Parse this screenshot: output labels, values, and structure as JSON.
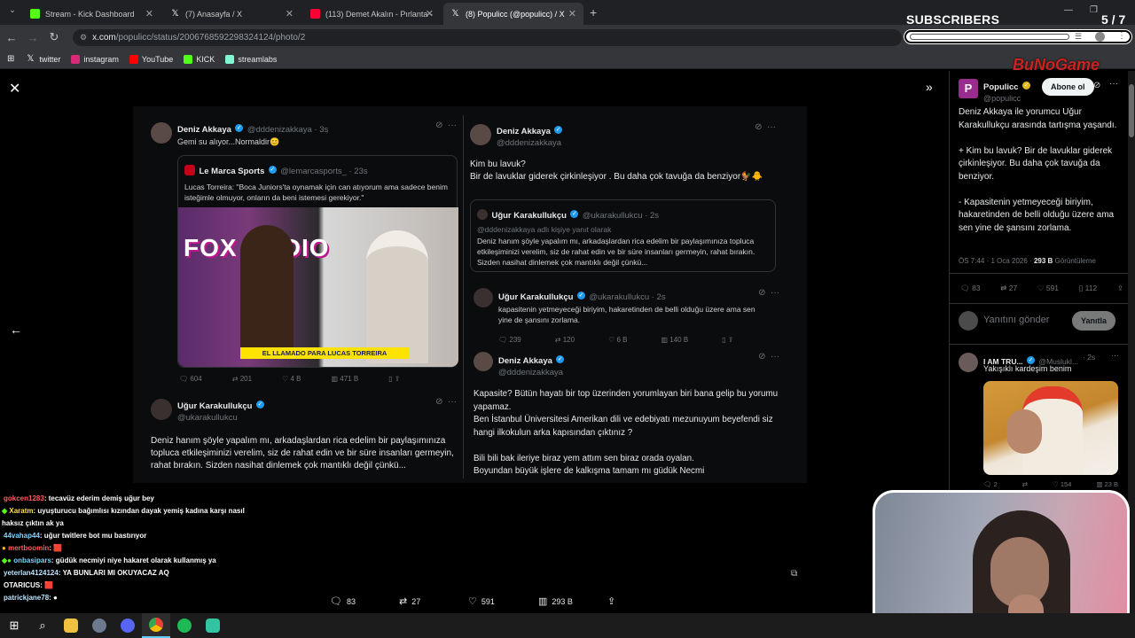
{
  "browser": {
    "tabs": [
      {
        "label": "Stream - Kick Dashboard",
        "color": "#53fc18"
      },
      {
        "label": "(7) Anasayfa / X",
        "color": "#ffffff"
      },
      {
        "label": "(113) Demet Akalın - Pırlanta -",
        "color": "#ff0033"
      },
      {
        "label": "(8) Populicc (@populicc) / X",
        "color": "#ffffff"
      }
    ],
    "new_tab": "+",
    "url_host": "x.com",
    "url_path": "/populicc/status/2006768592298324124/photo/2",
    "bookmarks": [
      {
        "label": "twitter",
        "color": "#ffffff"
      },
      {
        "label": "instagram",
        "color": "#d62976"
      },
      {
        "label": "YouTube",
        "color": "#ff0000"
      },
      {
        "label": "KICK",
        "color": "#53fc18"
      },
      {
        "label": "streamlabs",
        "color": "#80f5d2"
      }
    ]
  },
  "overlay": {
    "subscribers_label": "SUBSCRIBERS",
    "subscribers_count": "5 / 7",
    "logo_text": "BuNoGame"
  },
  "image": {
    "left_col": {
      "tweet1": {
        "name": "Deniz Akkaya",
        "handle": "@dddenizakkaya · 3s",
        "text": "Gemi su alıyor...Normaldir😊"
      },
      "quote": {
        "name": "Le Marca Sports",
        "handle": "@lemarcasports_ · 23s",
        "text": "Lucas Torreira: \"Boca Juniors'ta oynamak için can atıyorum ama sadece benim isteğimle olmuyor, onların da beni istemesi gerekiyor.\"",
        "photo_caption": "EL LLAMADO PARA LUCAS TORREIRA",
        "photo_logo": "FOX RADIO"
      },
      "metrics": [
        "604",
        "201",
        "4 B",
        "471 B"
      ],
      "tweet2": {
        "name": "Uğur Karakullukçu",
        "handle": "@ukarakullukcu",
        "text": "Deniz hanım şöyle yapalım mı, arkadaşlardan rica edelim bir paylaşımınıza topluca etkileşiminizi verelim, siz de rahat edin ve bir süre insanları germeyin, rahat bırakın. Sizden nasihat dinlemek çok mantıklı değil çünkü..."
      }
    },
    "right_col": {
      "tweet1": {
        "name": "Deniz Akkaya",
        "handle": "@dddenizakkaya",
        "text": "Kim bu lavuk?\nBir de lavuklar giderek çirkinleşiyor . Bu daha çok tavuğa da benziyor🐓🐥"
      },
      "quote": {
        "name": "Uğur Karakullukçu",
        "handle": "@ukarakullukcu · 2s",
        "reply_to": "@dddenizakkaya adlı kişiye yanıt olarak",
        "text": "Deniz hanım şöyle yapalım mı, arkadaşlardan rica edelim bir paylaşımınıza topluca etkileşiminizi verelim, siz de rahat edin ve bir süre insanları germeyin, rahat bırakın. Sizden nasihat dinlemek çok mantıklı değil çünkü..."
      },
      "tweet2": {
        "name": "Uğur Karakullukçu",
        "handle": "@ukarakullukcu · 2s",
        "text": "kapasitenin yetmeyeceği biriyim, hakaretinden de belli olduğu üzere ama sen yine de şansını zorlama.",
        "metrics": [
          "239",
          "120",
          "6 B",
          "140 B"
        ]
      },
      "tweet3": {
        "name": "Deniz Akkaya",
        "handle": "@dddenizakkaya",
        "text": "Kapasite? Bütün hayatı bir top üzerinden yorumlayan biri bana gelip bu yorumu yapamaz.\nBen İstanbul Üniversitesi Amerikan dili ve edebiyatı mezunuyum beyefendi siz hangi ilkokulun arka kapısından çıktınız ?\n\nBili bili bak ileriye biraz yem attım sen biraz orada oyalan.\nBoyundan büyük işlere de kalkışma tamam mı güdük Necmi"
      }
    }
  },
  "action_bar": {
    "replies": "83",
    "reposts": "27",
    "likes": "591",
    "views": "293 B"
  },
  "chat": [
    {
      "user": "gokcen1283",
      "color": "#ff5c5c",
      "text": ": tecavüz ederim demiş uğur bey"
    },
    {
      "user": "Xaratm",
      "color": "#ffe14d",
      "text": ": uyuşturucu bağımlısı kızından dayak yemiş kadına karşı nasıl haksız çıktın ak ya"
    },
    {
      "user": "44vahap44",
      "color": "#7fd4ff",
      "text": ": uğur twitlere bot mu bastırıyor"
    },
    {
      "user": "mertboomin",
      "color": "#ff5c5c",
      "text": ": 🟥"
    },
    {
      "user": "onbasipars",
      "color": "#7fd4ff",
      "text": ": güdük necmiyi niye hakaret olarak kullanmış ya"
    },
    {
      "user": "yeterlan4124124",
      "color": "#b9e3ff",
      "text": ": YA BUNLARI MI OKUYACAZ AQ"
    },
    {
      "user": "OTARICUS",
      "color": "#ffffff",
      "text": ": 🟥"
    },
    {
      "user": "patrickjane78",
      "color": "#b9e3ff",
      "text": ": ●"
    }
  ],
  "panel": {
    "name": "Populicc",
    "handle": "@populicc",
    "follow": "Abone ol",
    "body": "Deniz Akkaya ile yorumcu Uğur Karakullukçu arasında tartışma yaşandı.\n\n+ Kim bu lavuk? Bir de lavuklar giderek çirkinleşiyor. Bu daha çok tavuğa da benziyor.\n\n- Kapasitenin yetmeyeceği biriyim, hakaretinden de belli olduğu üzere ama sen yine de şansını zorlama.",
    "timestamp": "ÖS 7:44 · 1 Oca 2026 ·",
    "views_bold": "293 B",
    "views_label": "Görüntüleme",
    "metrics": [
      "83",
      "27",
      "591",
      "112"
    ],
    "reply_placeholder": "Yanıtını gönder",
    "reply_button": "Yanıtla",
    "reply": {
      "name": "I AM TRU...",
      "handle": "@Muslukl...",
      "time": "· 2s",
      "text": "Yakışıklı kardeşim benim",
      "metrics": [
        "2",
        "",
        "154",
        "23 B"
      ]
    }
  }
}
